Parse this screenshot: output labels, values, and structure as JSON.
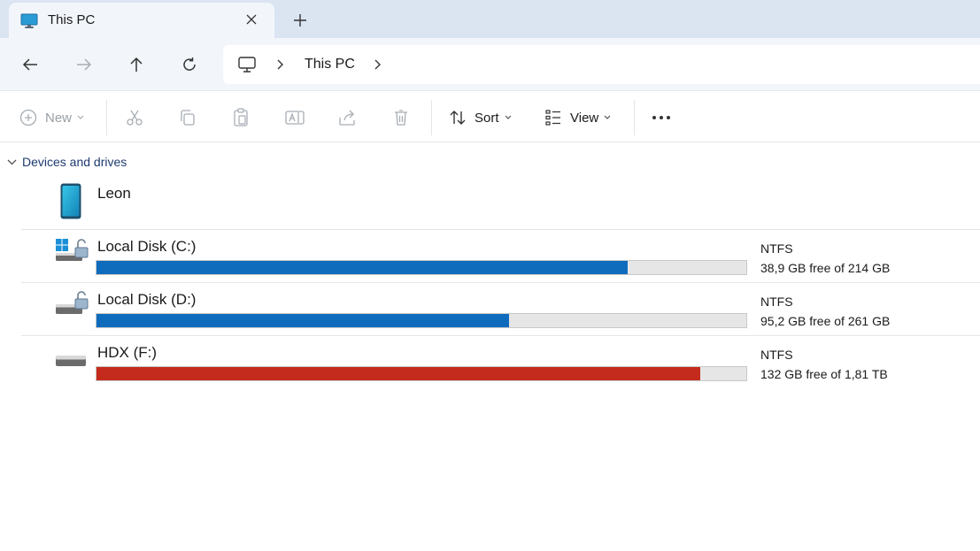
{
  "tab": {
    "title": "This PC",
    "icon": "monitor-icon"
  },
  "address": {
    "crumbs": [
      "This PC"
    ]
  },
  "commands": {
    "new_label": "New",
    "sort_label": "Sort",
    "view_label": "View"
  },
  "group": {
    "label": "Devices and drives"
  },
  "device": {
    "name": "Leon",
    "icon": "phone-icon"
  },
  "drives": [
    {
      "name": "Local Disk (C:)",
      "fs": "NTFS",
      "space": "38,9 GB free of 214 GB",
      "used_fraction": 0.818,
      "color": "#0f6cbd"
    },
    {
      "name": "Local Disk (D:)",
      "fs": "NTFS",
      "space": "95,2 GB free of 261 GB",
      "used_fraction": 0.635,
      "color": "#0f6cbd"
    },
    {
      "name": "HDX (F:)",
      "fs": "NTFS",
      "space": "132 GB free of 1,81 TB",
      "used_fraction": 0.929,
      "color": "#c42b1c"
    }
  ]
}
